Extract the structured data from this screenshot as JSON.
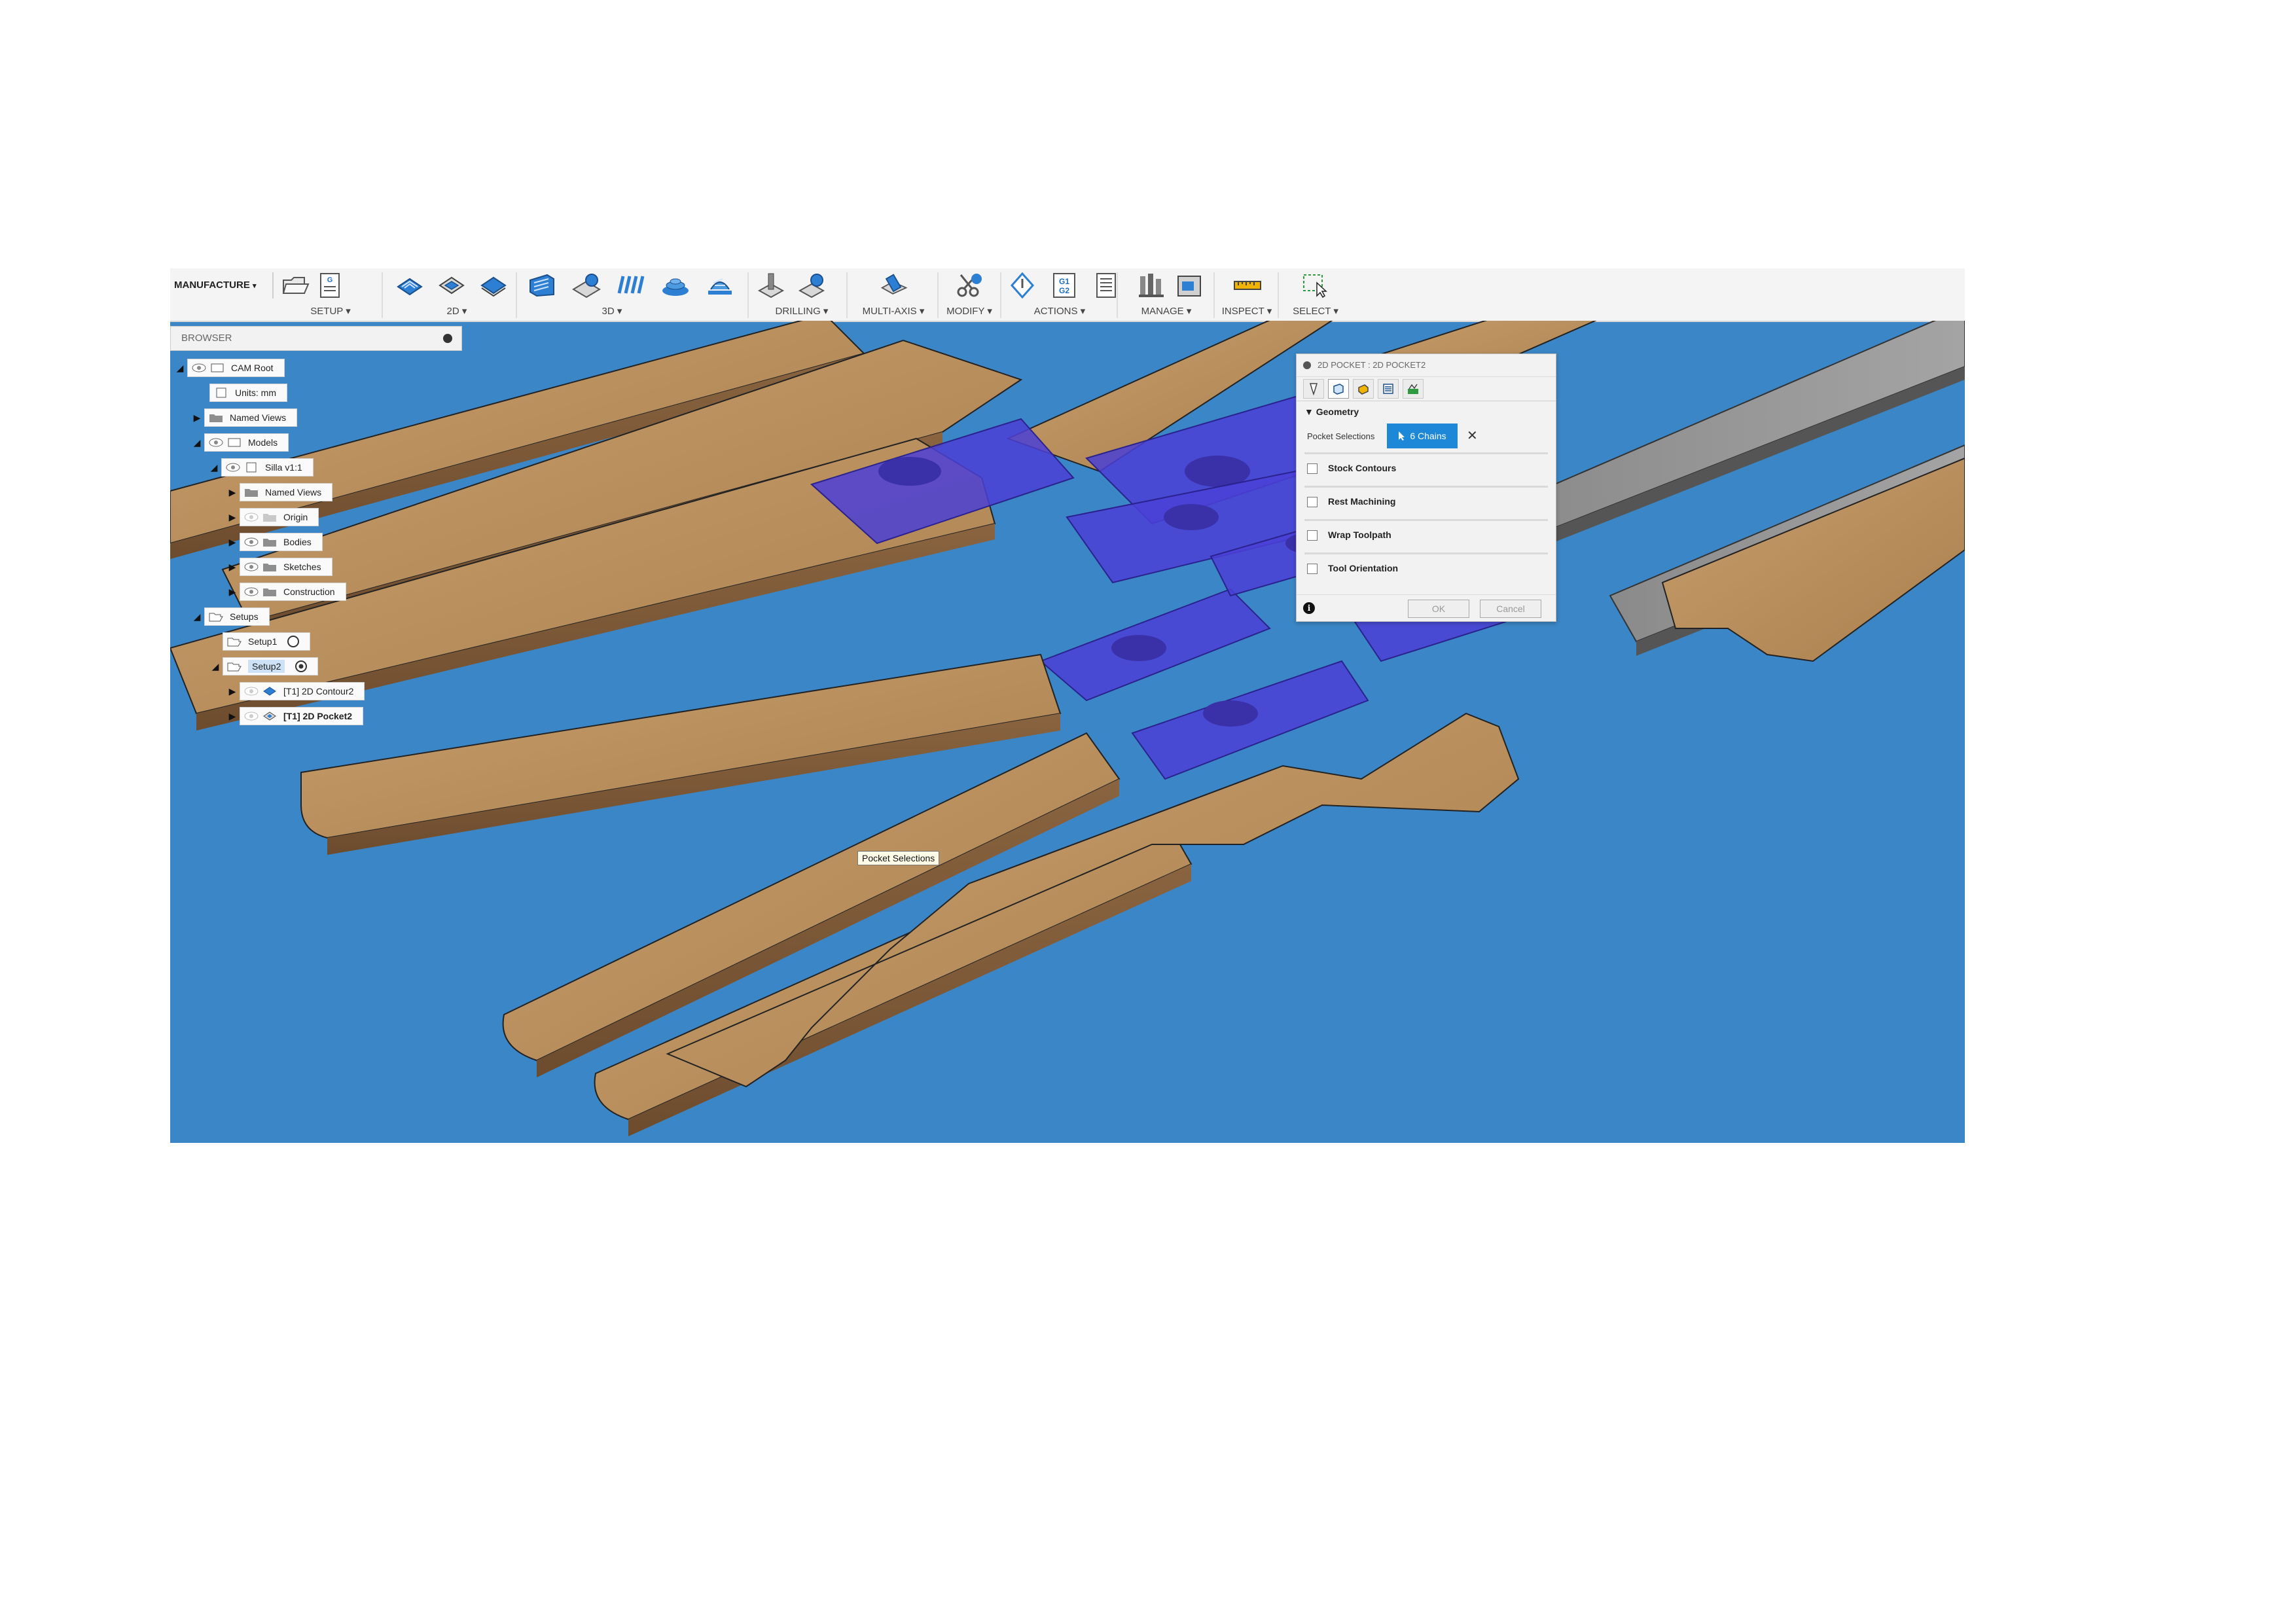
{
  "toolbar": {
    "workspace": "MANUFACTURE",
    "groups": [
      {
        "label": "SETUP"
      },
      {
        "label": "2D"
      },
      {
        "label": "3D"
      },
      {
        "label": "DRILLING"
      },
      {
        "label": "MULTI-AXIS"
      },
      {
        "label": "MODIFY"
      },
      {
        "label": "ACTIONS"
      },
      {
        "label": "MANAGE"
      },
      {
        "label": "INSPECT"
      },
      {
        "label": "SELECT"
      }
    ],
    "dropdown_glyph": "▾",
    "nc_code_icon_text": "G1\nG2"
  },
  "browser": {
    "title": "BROWSER",
    "nodes": [
      {
        "label": "CAM Root"
      },
      {
        "label": "Units: mm"
      },
      {
        "label": "Named Views"
      },
      {
        "label": "Models"
      },
      {
        "label": "Silla v1:1"
      },
      {
        "label": "Named Views"
      },
      {
        "label": "Origin"
      },
      {
        "label": "Bodies"
      },
      {
        "label": "Sketches"
      },
      {
        "label": "Construction"
      },
      {
        "label": "Setups"
      },
      {
        "label": "Setup1"
      },
      {
        "label": "Setup2"
      },
      {
        "label": "[T1] 2D Contour2"
      },
      {
        "label": "[T1] 2D Pocket2"
      }
    ]
  },
  "tooltip": "Pocket Selections",
  "dialog": {
    "title": "2D POCKET : 2D POCKET2",
    "geometry_header": "Geometry",
    "pocket_selections_label": "Pocket Selections",
    "pocket_selections_value": "6 Chains",
    "checkboxes": [
      {
        "label": "Stock Contours",
        "checked": false
      },
      {
        "label": "Rest Machining",
        "checked": false
      },
      {
        "label": "Wrap Toolpath",
        "checked": false
      },
      {
        "label": "Tool Orientation",
        "checked": false
      }
    ],
    "ok_label": "OK",
    "cancel_label": "Cancel"
  },
  "colors": {
    "viewport_bg": "#3b86c6",
    "wood": "#b98f5d",
    "selection": "#4b3fd6",
    "accent": "#1e88d8"
  }
}
